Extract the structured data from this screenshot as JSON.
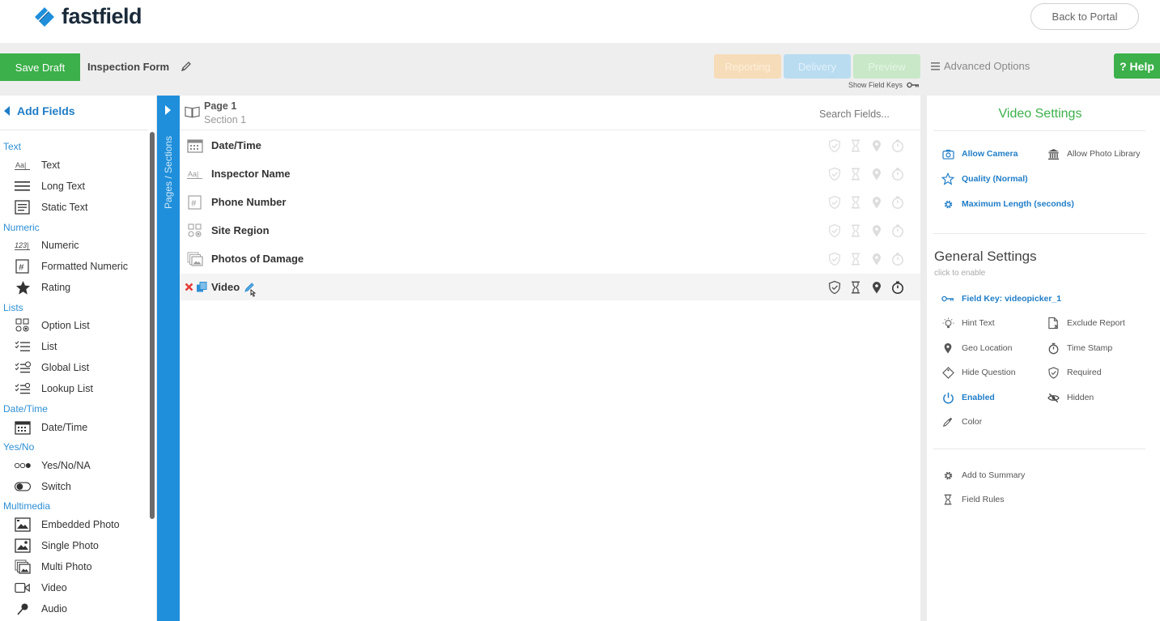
{
  "header": {
    "logo_text": "fastfield",
    "back_to_portal": "Back to Portal"
  },
  "toolbar": {
    "save_draft": "Save Draft",
    "form_name": "Inspection Form",
    "reporting": "Reporting",
    "delivery": "Delivery",
    "preview": "Preview",
    "advanced_options": "Advanced Options",
    "show_field_keys": "Show Field Keys",
    "help": "? Help"
  },
  "left_panel": {
    "title": "Add Fields",
    "categories": {
      "text": "Text",
      "numeric": "Numeric",
      "lists": "Lists",
      "datetime": "Date/Time",
      "yesno": "Yes/No",
      "multimedia": "Multimedia"
    },
    "items": {
      "text": "Text",
      "long_text": "Long Text",
      "static_text": "Static Text",
      "numeric": "Numeric",
      "formatted_numeric": "Formatted Numeric",
      "rating": "Rating",
      "option_list": "Option List",
      "list": "List",
      "global_list": "Global List",
      "lookup_list": "Lookup List",
      "datetime": "Date/Time",
      "yes_no_na": "Yes/No/NA",
      "switch": "Switch",
      "embedded_photo": "Embedded Photo",
      "single_photo": "Single Photo",
      "multi_photo": "Multi Photo",
      "video": "Video",
      "audio": "Audio"
    }
  },
  "pages_strip": {
    "label": "Pages / Sections"
  },
  "center": {
    "page_title": "Page 1",
    "section_title": "Section 1",
    "search_placeholder": "Search Fields...",
    "fields": [
      {
        "label": "Date/Time"
      },
      {
        "label": "Inspector Name"
      },
      {
        "label": "Phone Number"
      },
      {
        "label": "Site Region"
      },
      {
        "label": "Photos of Damage"
      },
      {
        "label": "Video"
      }
    ]
  },
  "right_panel": {
    "video_settings_title": "Video Settings",
    "allow_camera": "Allow Camera",
    "allow_photo_library": "Allow Photo Library",
    "quality": "Quality (Normal)",
    "max_length": "Maximum Length (seconds)",
    "general_title": "General Settings",
    "general_sub": "click to enable",
    "field_key": "Field Key: videopicker_1",
    "hint_text": "Hint Text",
    "exclude_report": "Exclude Report",
    "geo_location": "Geo Location",
    "time_stamp": "Time Stamp",
    "hide_question": "Hide Question",
    "required": "Required",
    "enabled": "Enabled",
    "hidden": "Hidden",
    "color": "Color",
    "add_to_summary": "Add to Summary",
    "field_rules": "Field Rules"
  },
  "colors": {
    "green": "#3cb04a",
    "blue": "#1f7dc7",
    "strip_blue": "#1f8fdb"
  }
}
